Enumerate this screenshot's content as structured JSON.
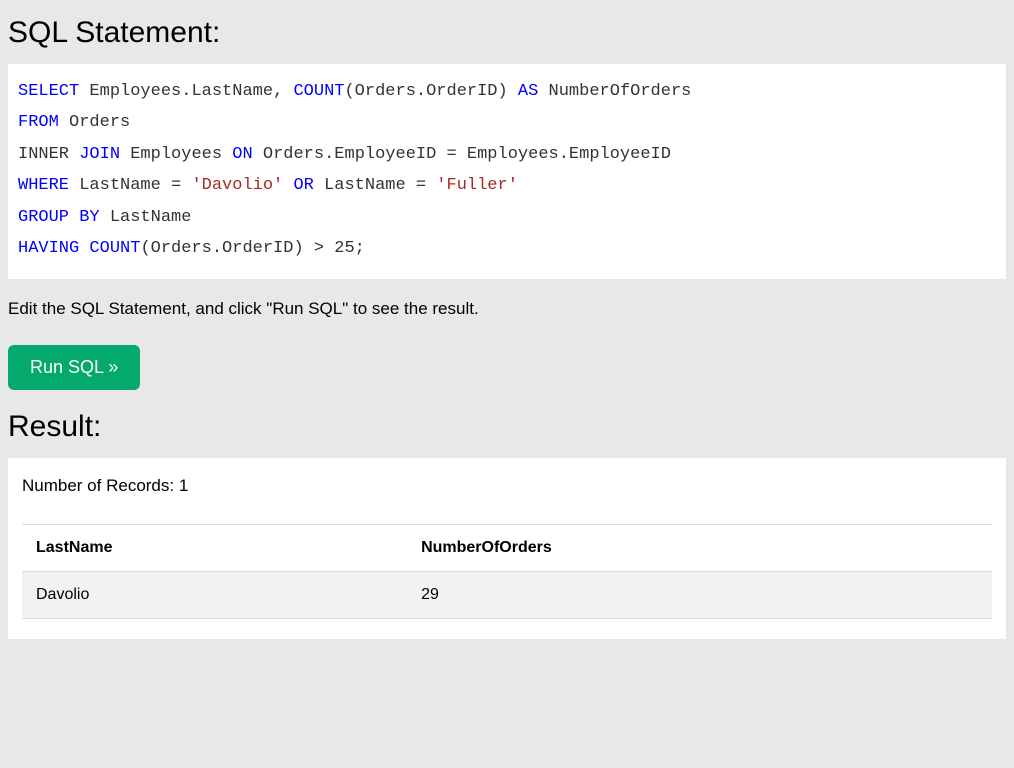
{
  "headings": {
    "sql_statement": "SQL Statement:",
    "result": "Result:"
  },
  "sql": {
    "tokens": [
      {
        "t": "kw",
        "v": "SELECT"
      },
      {
        "t": "sp",
        "v": " "
      },
      {
        "t": "ident",
        "v": "Employees.LastName"
      },
      {
        "t": "punct",
        "v": ", "
      },
      {
        "t": "fn",
        "v": "COUNT"
      },
      {
        "t": "punct",
        "v": "(Orders.OrderID) "
      },
      {
        "t": "kw",
        "v": "AS"
      },
      {
        "t": "sp",
        "v": " "
      },
      {
        "t": "ident",
        "v": "NumberOfOrders"
      },
      {
        "t": "nl",
        "v": "\n"
      },
      {
        "t": "kw",
        "v": "FROM"
      },
      {
        "t": "sp",
        "v": " "
      },
      {
        "t": "ident",
        "v": "Orders"
      },
      {
        "t": "nl",
        "v": "\n"
      },
      {
        "t": "ident",
        "v": "INNER"
      },
      {
        "t": "sp",
        "v": " "
      },
      {
        "t": "kw",
        "v": "JOIN"
      },
      {
        "t": "sp",
        "v": " "
      },
      {
        "t": "ident",
        "v": "Employees "
      },
      {
        "t": "kw",
        "v": "ON"
      },
      {
        "t": "sp",
        "v": " "
      },
      {
        "t": "ident",
        "v": "Orders.EmployeeID = Employees.EmployeeID"
      },
      {
        "t": "nl",
        "v": "\n"
      },
      {
        "t": "kw",
        "v": "WHERE"
      },
      {
        "t": "sp",
        "v": " "
      },
      {
        "t": "ident",
        "v": "LastName = "
      },
      {
        "t": "str",
        "v": "'Davolio'"
      },
      {
        "t": "sp",
        "v": " "
      },
      {
        "t": "kw",
        "v": "OR"
      },
      {
        "t": "sp",
        "v": " "
      },
      {
        "t": "ident",
        "v": "LastName = "
      },
      {
        "t": "str",
        "v": "'Fuller'"
      },
      {
        "t": "nl",
        "v": "\n"
      },
      {
        "t": "kw",
        "v": "GROUP"
      },
      {
        "t": "sp",
        "v": " "
      },
      {
        "t": "kw",
        "v": "BY"
      },
      {
        "t": "sp",
        "v": " "
      },
      {
        "t": "ident",
        "v": "LastName"
      },
      {
        "t": "nl",
        "v": "\n"
      },
      {
        "t": "kw",
        "v": "HAVING"
      },
      {
        "t": "sp",
        "v": " "
      },
      {
        "t": "fn",
        "v": "COUNT"
      },
      {
        "t": "ident",
        "v": "(Orders.OrderID) > 25;"
      }
    ]
  },
  "instructions": "Edit the SQL Statement, and click \"Run SQL\" to see the result.",
  "buttons": {
    "run_sql": "Run SQL »"
  },
  "result": {
    "records_label": "Number of Records: 1",
    "columns": [
      "LastName",
      "NumberOfOrders"
    ],
    "rows": [
      [
        "Davolio",
        "29"
      ]
    ]
  }
}
